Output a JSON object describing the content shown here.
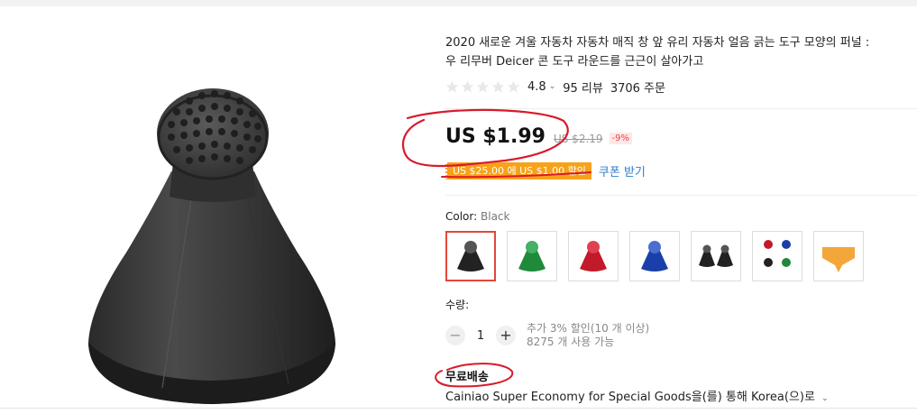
{
  "product": {
    "title_line1": "2020 새로운 겨울 자동차 자동차 매직 창 앞 유리 자동차 얼음 긁는 도구 모양의 퍼널 :",
    "title_line2": "우 리무버 Deicer 콘 도구 라운드를 근근이 살아가고",
    "image_name": "black scraper cone"
  },
  "rating": {
    "value": "4.8",
    "stars": 0,
    "reviews": "95 리뷰",
    "orders": "3706 주문"
  },
  "price": {
    "current": "US $1.99",
    "original": "US $2.19",
    "discount": "-9%"
  },
  "coupon": {
    "badge": "US $25.00 에 US $1.00 할인",
    "link": "쿠폰 받기"
  },
  "color": {
    "label": "Color:",
    "selected": "Black",
    "options": [
      "black",
      "green",
      "red",
      "blue",
      "black pair",
      "four colors",
      "orange tag"
    ]
  },
  "quantity": {
    "label": "수량:",
    "value": "1",
    "minus": "−",
    "plus": "+",
    "discount_note": "추가 3% 할인(10 개 이상)",
    "available": "8275 개 사용 가능"
  },
  "shipping": {
    "title": "무료배송",
    "description": "Cainiao Super Economy for Special Goods을(를) 통해 Korea(으)로"
  },
  "colors": {
    "accent_red": "#e3463a",
    "coupon_orange": "#f7a21b",
    "link_blue": "#2e7dcf",
    "annotation_red": "#d91a2a"
  }
}
